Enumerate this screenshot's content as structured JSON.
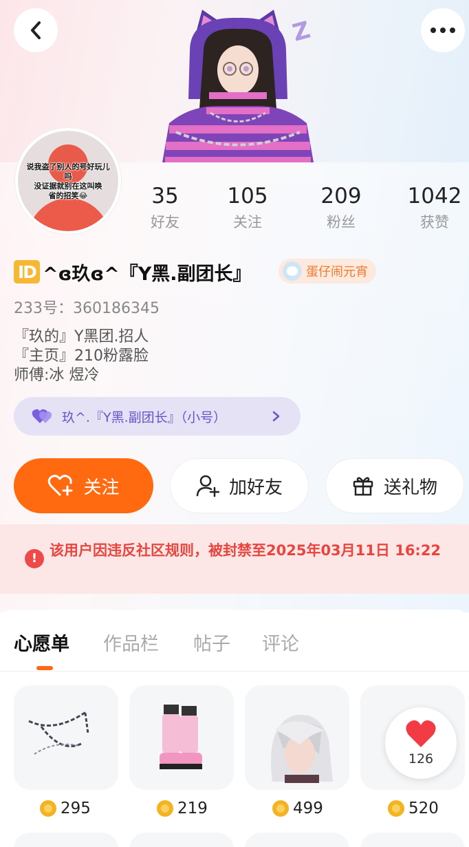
{
  "nav": {
    "back_icon": "chevron-left-icon",
    "more_icon": "more-dots-icon"
  },
  "avatar_caption": [
    "说我盗了别人的号好玩儿",
    "吗",
    "没证据就别在这叫唤",
    "省的招笑😂"
  ],
  "stats": [
    {
      "value": "35",
      "label": "好友"
    },
    {
      "value": "105",
      "label": "关注"
    },
    {
      "value": "209",
      "label": "粉丝"
    },
    {
      "value": "1042",
      "label": "获赞"
    }
  ],
  "profile": {
    "id_badge": "ID",
    "nickname": "^ɞ玖ɞ^『Y黑.副团长』",
    "tag": "蛋仔闹元宵",
    "uid": "233号：360186345",
    "bio": [
      "『玖的』Y黑团.招人",
      "『主页』210粉露脸",
      "师傅:冰 煜冷"
    ],
    "alt_account": "玖^.『Y黑.副团长』（小号）"
  },
  "actions": {
    "follow": "关注",
    "add_friend": "加好友",
    "gift": "送礼物"
  },
  "ban_notice": "该用户因违反社区规则，被封禁至2025年03月11日 16:22",
  "tabs": [
    {
      "label": "心愿单",
      "active": true
    },
    {
      "label": "作品栏",
      "active": false
    },
    {
      "label": "帖子",
      "active": false
    },
    {
      "label": "评论",
      "active": false
    }
  ],
  "wishlist": [
    {
      "item": "chain-accessory",
      "price": "295"
    },
    {
      "item": "leg-warmers",
      "price": "219"
    },
    {
      "item": "white-hair",
      "price": "499"
    },
    {
      "item": "item-4",
      "price": "520"
    }
  ],
  "wish_count": "126",
  "colors": {
    "accent": "#ff6a10",
    "ban_text": "#e8453f",
    "alt_chip": "#e6e2f6"
  }
}
